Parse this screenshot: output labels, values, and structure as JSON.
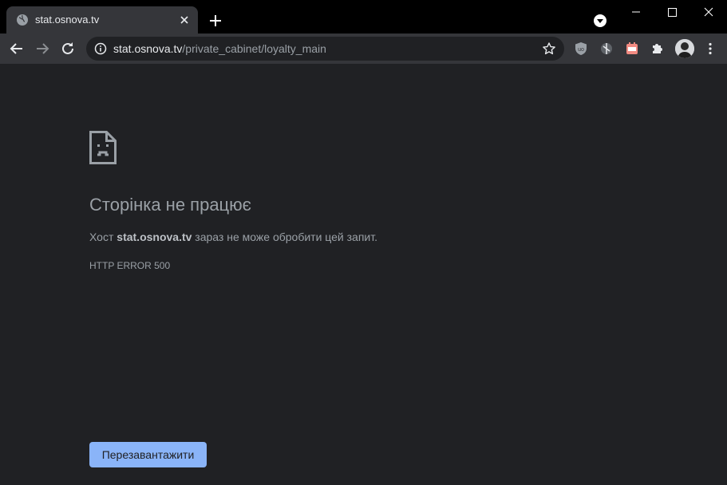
{
  "browser": {
    "tab": {
      "title": "stat.osnova.tv",
      "favicon": "globe-icon"
    },
    "omnibox": {
      "host": "stat.osnova.tv",
      "path": "/private_cabinet/loyalty_main"
    },
    "extensions": [
      "ublock-origin-icon",
      "extension-icon",
      "extension-icon",
      "puzzle-icon"
    ]
  },
  "error_page": {
    "title": "Сторінка не працює",
    "desc_prefix": "Хост ",
    "desc_host": "stat.osnova.tv",
    "desc_suffix": " зараз не може обробити цей запит.",
    "error_code": "HTTP ERROR 500",
    "reload_label": "Перезавантажити"
  },
  "colors": {
    "page_bg": "#202124",
    "toolbar_bg": "#35363a",
    "titlebar_bg": "#000000",
    "button_bg": "#8ab4f8",
    "text_muted": "#9aa0a6"
  }
}
